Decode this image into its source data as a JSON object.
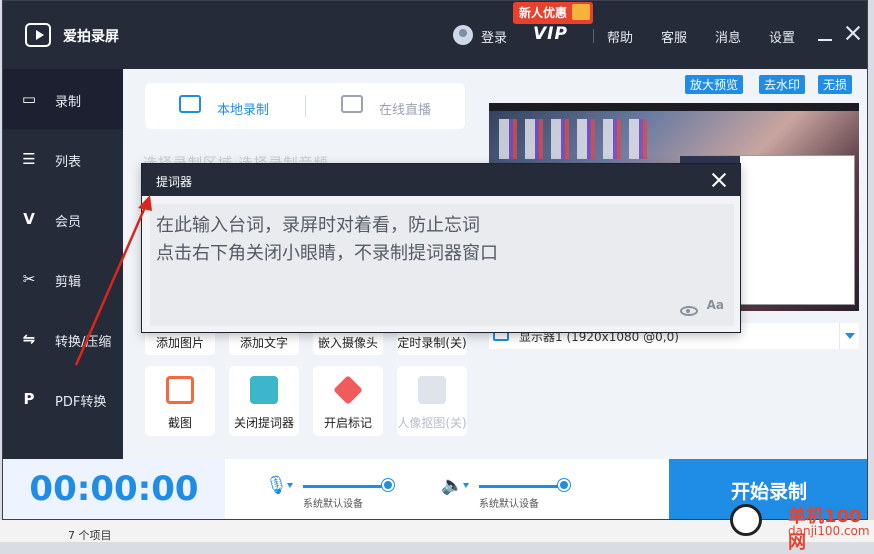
{
  "app": {
    "title": "爱拍录屏"
  },
  "titlebar": {
    "login": "登录",
    "vip": "VIP",
    "vip_promo": "新人优惠",
    "help": "帮助",
    "support": "客服",
    "messages": "消息",
    "settings": "设置"
  },
  "sidebar": {
    "items": [
      {
        "label": "录制",
        "icon": "camera-icon"
      },
      {
        "label": "列表",
        "icon": "list-icon"
      },
      {
        "label": "会员",
        "icon": "vip-icon"
      },
      {
        "label": "剪辑",
        "icon": "scissors-icon"
      },
      {
        "label": "转换/压缩",
        "icon": "convert-icon"
      },
      {
        "label": "PDF转换",
        "icon": "pdf-icon"
      }
    ]
  },
  "tabs": [
    {
      "label": "本地录制",
      "active": true
    },
    {
      "label": "在线直播",
      "active": false
    }
  ],
  "faded_labels": "选择录制区域  选择录制音频",
  "prompter": {
    "title": "提词器",
    "line1": "在此输入台词，录屏时对着看，防止忘词",
    "line2": "点击右下角关闭小眼睛，不录制提词器窗口",
    "font_toggle": "Aa"
  },
  "tools_row1": [
    "添加图片",
    "添加文字",
    "嵌入摄像头",
    "定时录制(关)"
  ],
  "tools_row2": [
    {
      "label": "截图",
      "icon": "crop-icon"
    },
    {
      "label": "关闭提词器",
      "icon": "teleprompter-icon"
    },
    {
      "label": "开启标记",
      "icon": "marker-icon"
    },
    {
      "label": "人像抠图(关)",
      "icon": "portrait-icon",
      "disabled": true
    }
  ],
  "preview": {
    "badges": [
      "放大预览",
      "去水印",
      "无损"
    ],
    "monitor": "显示器1 (1920x1080 @0,0)"
  },
  "recorder": {
    "time": "00:00:00",
    "mic_label": "系统默认设备",
    "mic_level": 0.97,
    "speaker_label": "系统默认设备",
    "speaker_level": 0.97,
    "start": "开始录制"
  },
  "outside": {
    "status": "7 个项目"
  },
  "watermark": {
    "title": "单机100网",
    "url": "danji100.com"
  },
  "colors": {
    "accent": "#1f8de6",
    "dark": "#262b3a",
    "promo": "#e8412e"
  }
}
